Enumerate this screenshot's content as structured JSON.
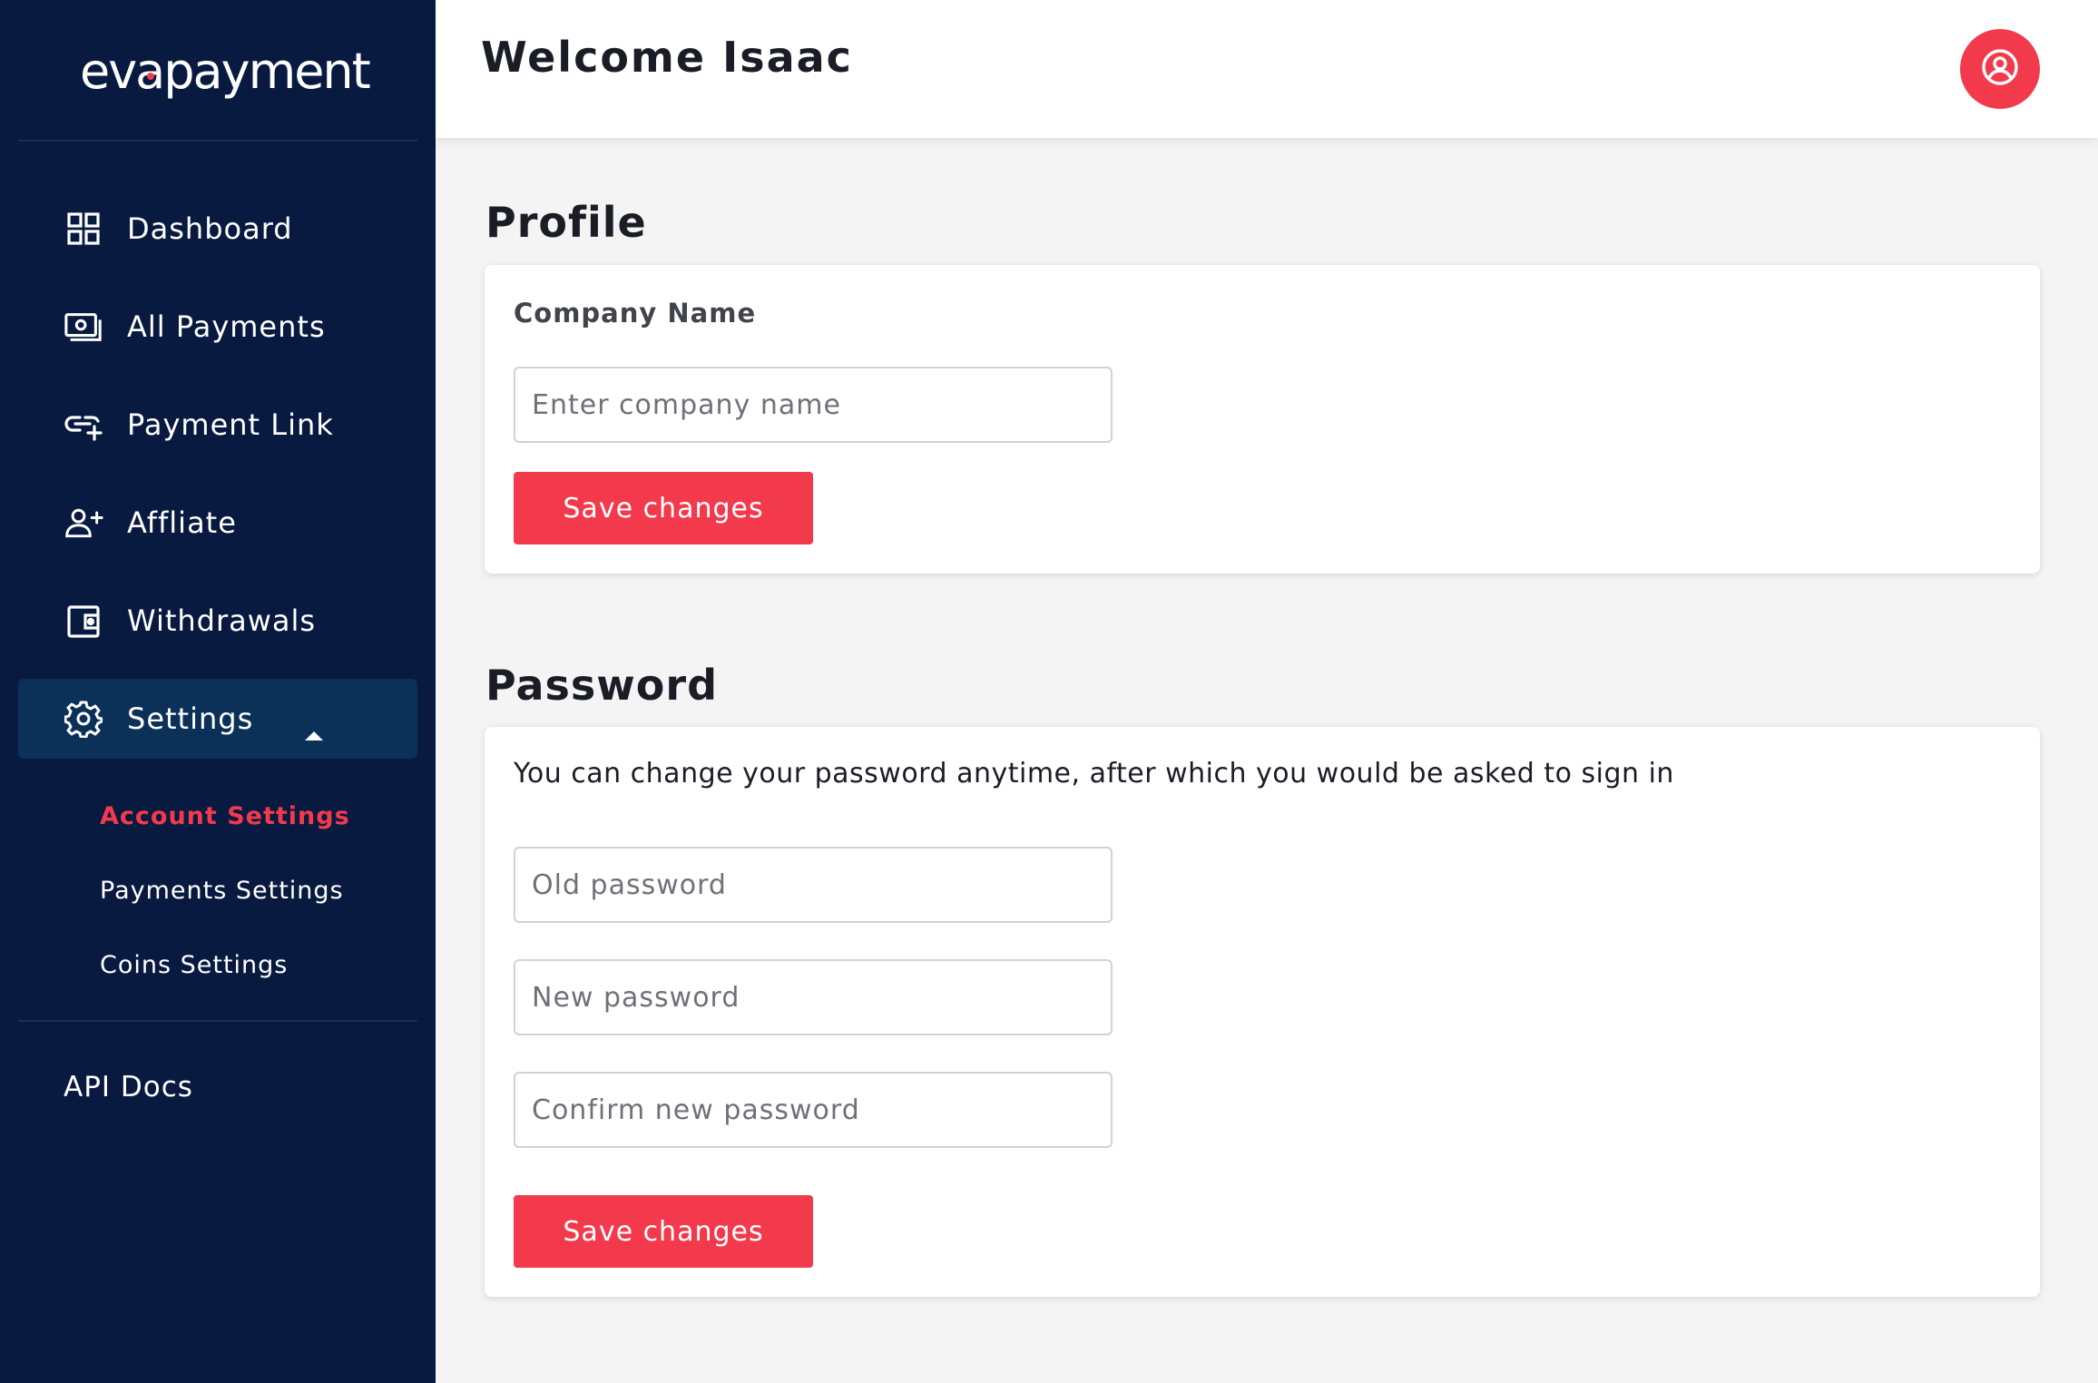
{
  "brand": {
    "logo_text": "evapayment",
    "accent_color": "#f23a4c",
    "sidebar_color": "#081a40"
  },
  "sidebar": {
    "items": [
      {
        "label": "Dashboard",
        "icon": "dashboard-grid-icon"
      },
      {
        "label": "All Payments",
        "icon": "cash-icon"
      },
      {
        "label": "Payment Link",
        "icon": "link-add-icon"
      },
      {
        "label": "Affliate",
        "icon": "user-add-icon"
      },
      {
        "label": "Withdrawals",
        "icon": "wallet-icon"
      },
      {
        "label": "Settings",
        "icon": "gear-icon",
        "expanded": true
      }
    ],
    "sub_items": [
      {
        "label": "Account Settings",
        "active": true
      },
      {
        "label": "Payments Settings",
        "active": false
      },
      {
        "label": "Coins Settings",
        "active": false
      }
    ],
    "api_docs": "API Docs"
  },
  "header": {
    "welcome": "Welcome Isaac",
    "avatar_icon": "user-circle-icon"
  },
  "profile": {
    "title": "Profile",
    "company_label": "Company Name",
    "company_placeholder": "Enter company name",
    "company_value": "",
    "save_label": "Save changes"
  },
  "password": {
    "title": "Password",
    "description": "You can change your password anytime, after which you would be asked to sign in",
    "old_placeholder": "Old password",
    "new_placeholder": "New password",
    "confirm_placeholder": "Confirm new password",
    "save_label": "Save changes"
  }
}
